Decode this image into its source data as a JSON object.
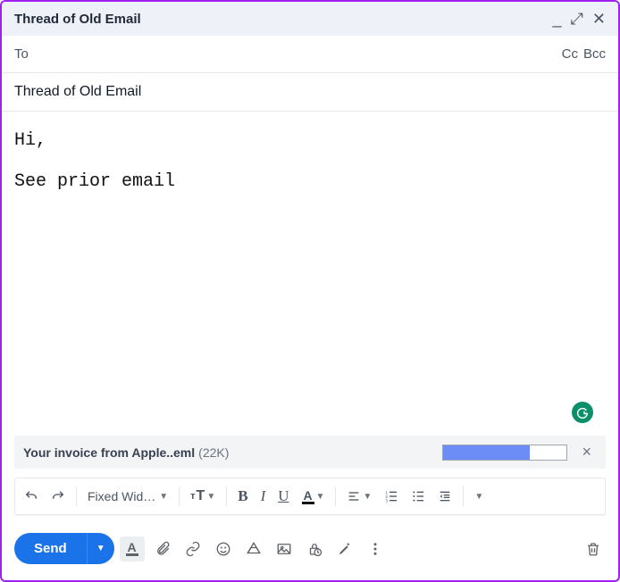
{
  "titlebar": {
    "title": "Thread of Old Email"
  },
  "recipients": {
    "to_label": "To",
    "cc": "Cc",
    "bcc": "Bcc"
  },
  "subject": "Thread of Old Email",
  "body": {
    "line1": "Hi,",
    "line2": "See prior email"
  },
  "attachment": {
    "filename": "Your invoice from Apple..eml",
    "size": "(22K)",
    "progress_pct": 70
  },
  "toolbar": {
    "font_name": "Fixed Wid…"
  },
  "send": {
    "label": "Send"
  },
  "colors": {
    "accent": "#1a73e8",
    "progress": "#6b8df5",
    "grammarly": "#0a8f6b"
  }
}
